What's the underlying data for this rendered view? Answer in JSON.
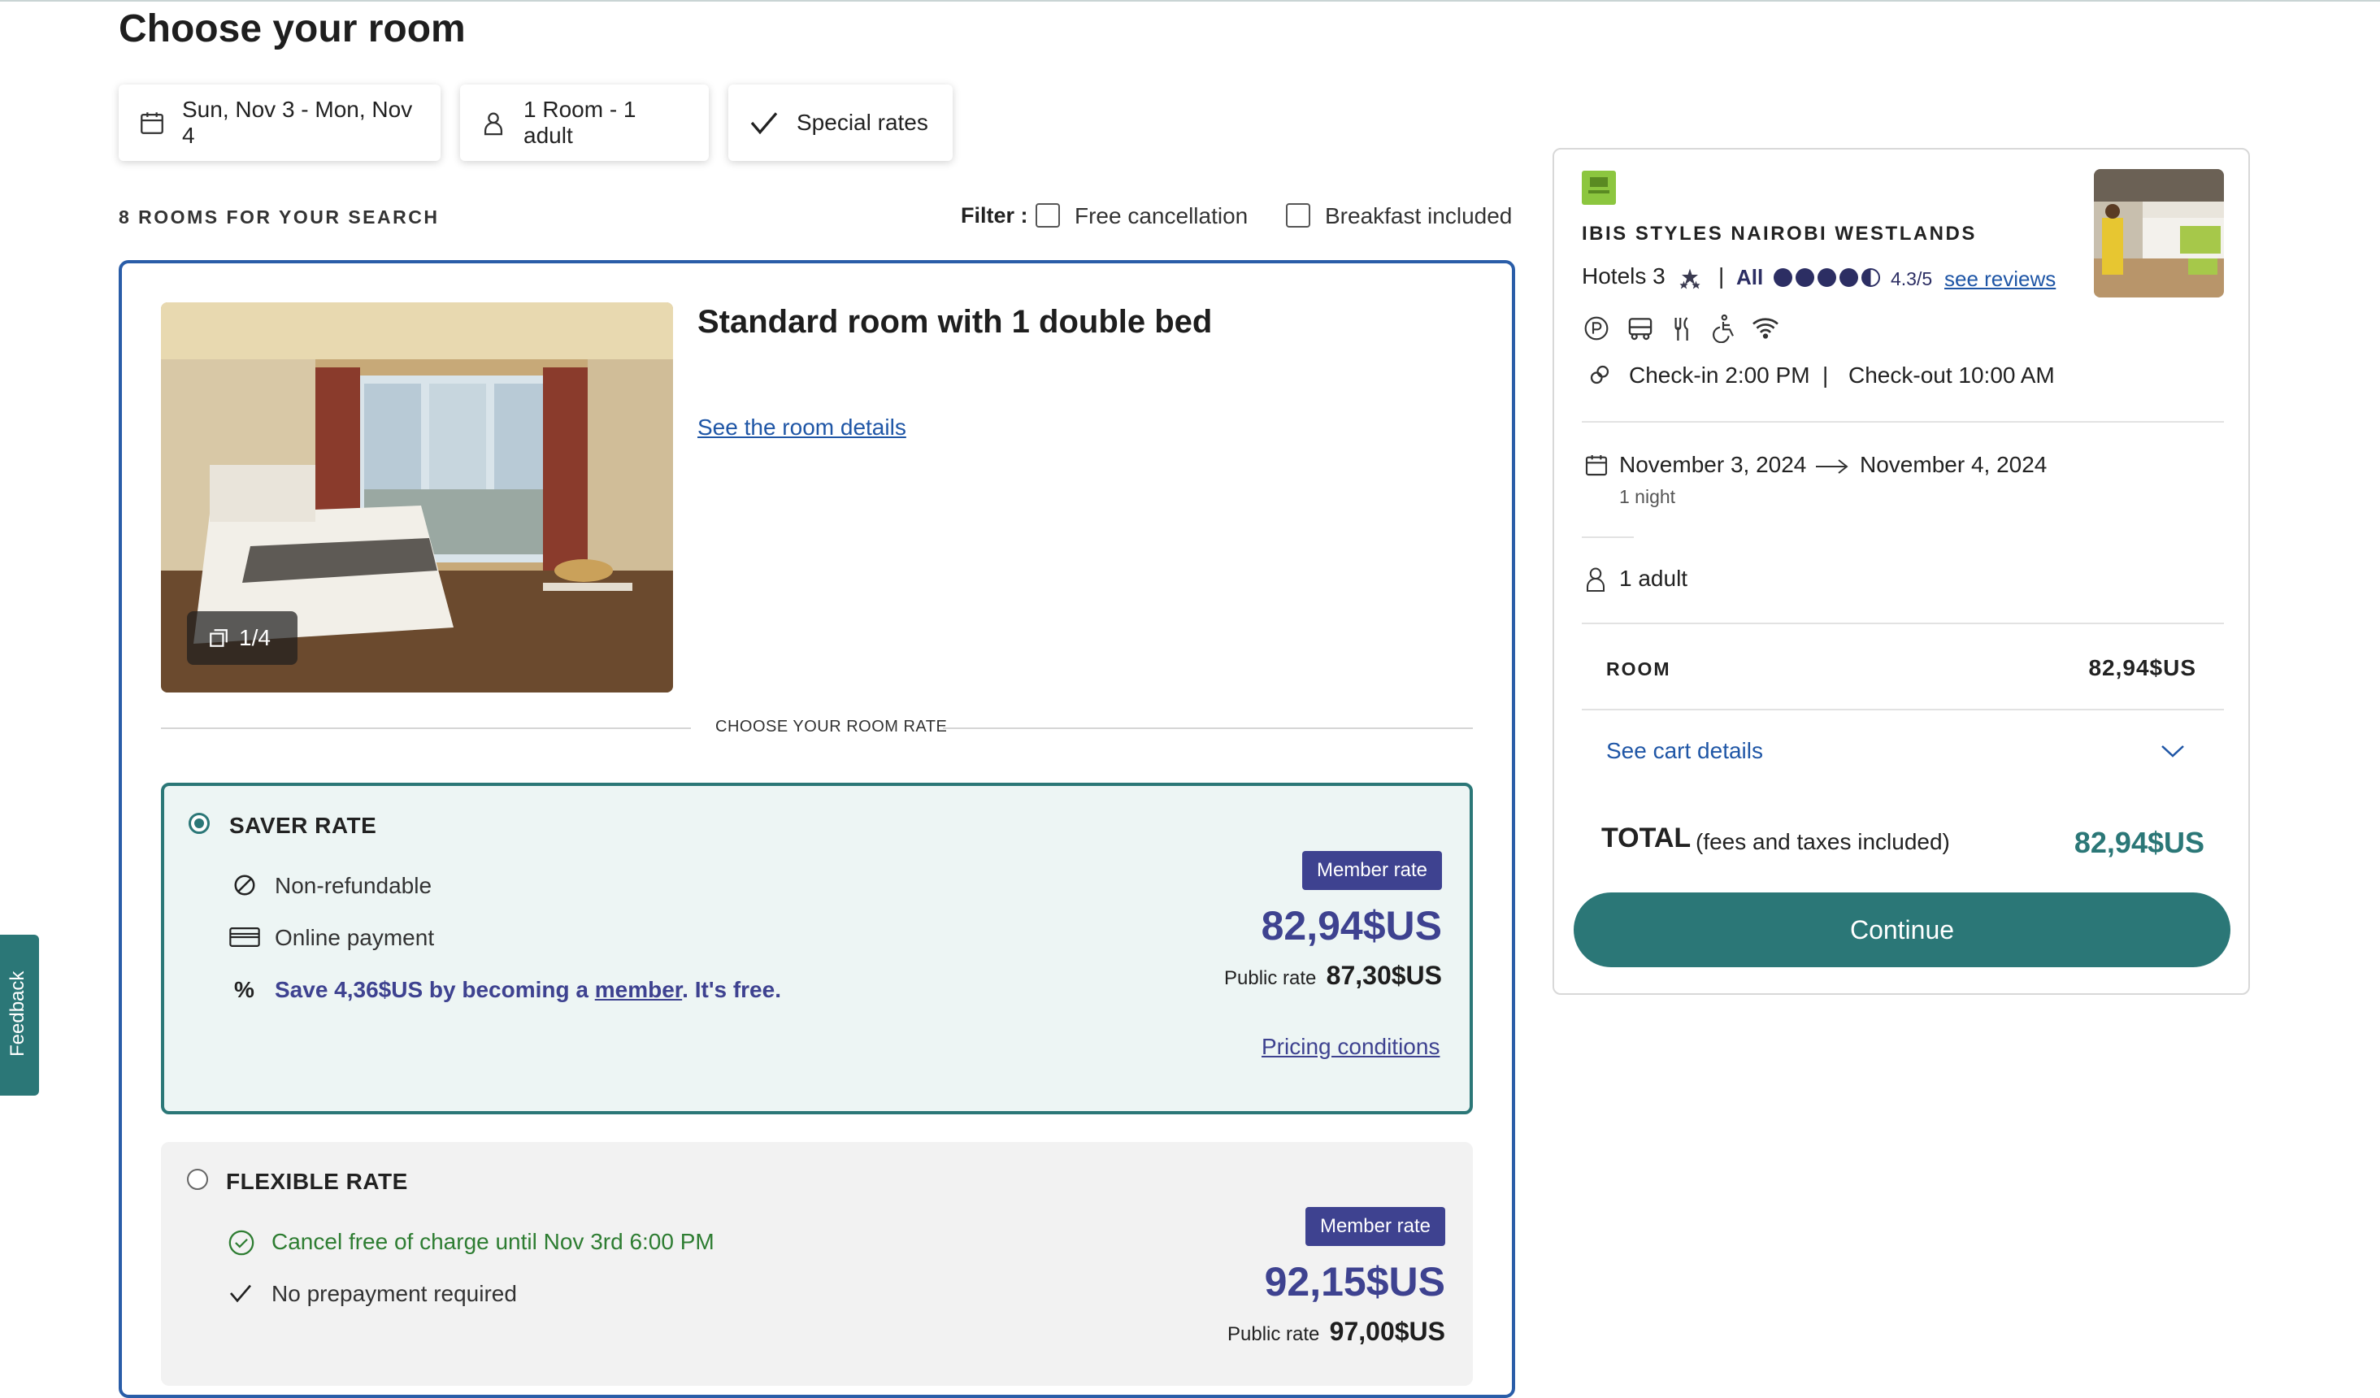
{
  "page": {
    "title": "Choose your room"
  },
  "search_chips": {
    "dates": "Sun, Nov 3 - Mon, Nov 4",
    "occupancy": "1 Room - 1 adult",
    "special_rates": "Special rates"
  },
  "results": {
    "count_label": "8 ROOMS FOR YOUR SEARCH",
    "filter_label": "Filter :",
    "filters": [
      {
        "label": "Free cancellation",
        "checked": false
      },
      {
        "label": "Breakfast included",
        "checked": false
      }
    ]
  },
  "room": {
    "title": "Standard room with 1 double bed",
    "details_link": "See the room details",
    "image_counter": "1/4",
    "choose_rate_label": "CHOOSE YOUR ROOM RATE"
  },
  "rates": [
    {
      "name": "SAVER RATE",
      "selected": true,
      "features": [
        {
          "icon": "no-entry-icon",
          "text": "Non-refundable"
        },
        {
          "icon": "credit-card-icon",
          "text": "Online payment"
        }
      ],
      "member_note": {
        "prefix": "Save 4,36$US by becoming a ",
        "link": "member",
        "suffix": ". It's free."
      },
      "member_badge": "Member rate",
      "member_price": "82,94$US",
      "public_label": "Public rate",
      "public_price": "87,30$US",
      "conditions_link": "Pricing conditions"
    },
    {
      "name": "FLEXIBLE RATE",
      "selected": false,
      "features": [
        {
          "icon": "check-circle-icon",
          "text": "Cancel free of charge until Nov 3rd 6:00 PM"
        },
        {
          "icon": "check-icon",
          "text": "No prepayment required"
        }
      ],
      "member_badge": "Member rate",
      "member_price": "92,15$US",
      "public_label": "Public rate",
      "public_price": "97,00$US"
    }
  ],
  "feedback": {
    "label": "Feedback"
  },
  "summary": {
    "hotel_name": "IBIS STYLES NAIROBI WESTLANDS",
    "hotel_category": "Hotels 3",
    "brand": "All",
    "rating": "4.3/5",
    "rating_value": 4.3,
    "reviews_link": "see reviews",
    "amenity_icons": [
      "parking-icon",
      "bus-icon",
      "restaurant-icon",
      "accessibility-icon",
      "wifi-icon"
    ],
    "check_in": "Check-in 2:00 PM",
    "check_separator": "|",
    "check_out": "Check-out 10:00 AM",
    "date_from": "November 3, 2024",
    "date_to": "November 4, 2024",
    "nights": "1 night",
    "guests": "1 adult",
    "room_label": "ROOM",
    "room_price": "82,94$US",
    "cart_link": "See cart details",
    "total_label": "TOTAL",
    "total_note": "(fees and taxes included)",
    "total_price": "82,94$US",
    "continue_label": "Continue"
  },
  "colors": {
    "teal": "#2b7777",
    "member_blue": "#3e4290",
    "link_blue": "#1f56a6",
    "card_border": "#2a5da8",
    "green": "#2e7d32"
  }
}
